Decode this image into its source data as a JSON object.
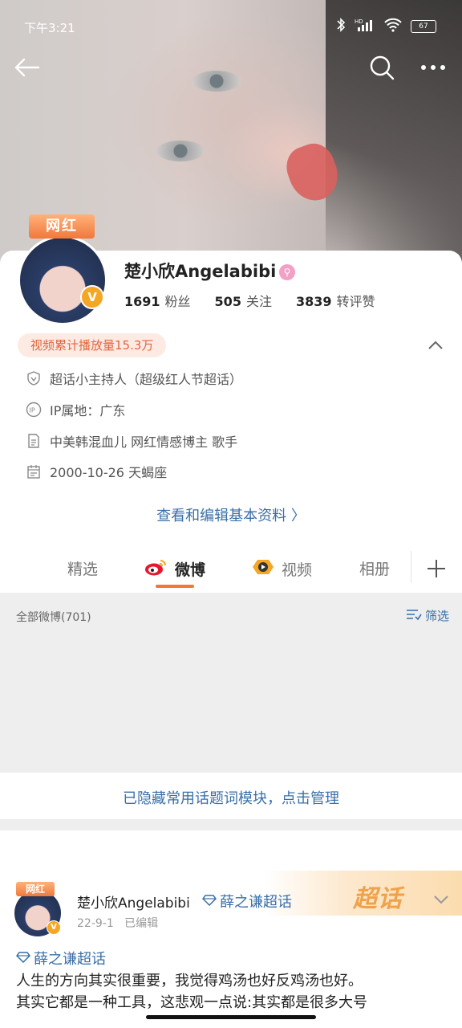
{
  "status_bar": {
    "time": "下午3:21",
    "battery": "67"
  },
  "profile": {
    "badge": "网红",
    "name": "楚小欣Angelabibi",
    "followers_count": "1691",
    "followers_label": "粉丝",
    "following_count": "505",
    "following_label": "关注",
    "interactions_count": "3839",
    "interactions_label": "转评赞",
    "video_plays_tag": "视频累计播放量15.3万",
    "info": [
      {
        "icon": "verified-shield-icon",
        "text": "超话小主持人（超级红人节超话）"
      },
      {
        "icon": "ip-icon",
        "text": "IP属地：广东"
      },
      {
        "icon": "document-icon",
        "text": "中美韩混血儿 网红情感博主 歌手"
      },
      {
        "icon": "calendar-icon",
        "text": "2000-10-26 天蝎座"
      }
    ],
    "edit_link": "查看和编辑基本资料 〉"
  },
  "tabs": [
    {
      "label": "精选"
    },
    {
      "label": "微博",
      "active": true
    },
    {
      "label": "视频"
    },
    {
      "label": "相册"
    }
  ],
  "feed": {
    "all_weibo": "全部微博(701)",
    "filter_label": "筛选",
    "hidden_module_notice": "已隐藏常用话题词模块，点击管理"
  },
  "post": {
    "badge": "网红",
    "author": "楚小欣Angelabibi",
    "topic_inline": "薛之谦超话",
    "date": "22-9-1",
    "edited": "已编辑",
    "super_topic_label": "超话",
    "topic": "薛之谦超话",
    "body_line1": "人生的方向其实很重要，我觉得鸡汤也好反鸡汤也好。",
    "body_line2": "其实它都是一种工具，这悲观一点说:其实都是很多大号"
  },
  "colors": {
    "accent_orange": "#f07830",
    "link_blue": "#3a6fa8"
  }
}
